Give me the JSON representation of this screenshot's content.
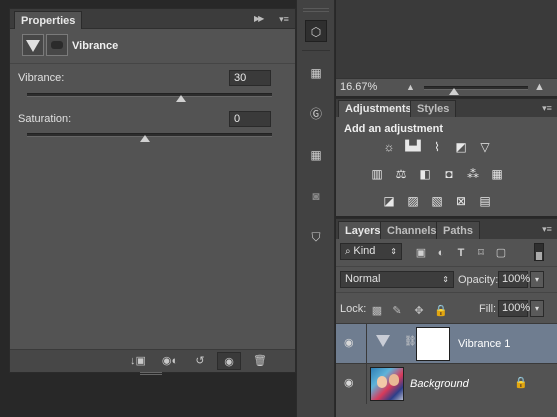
{
  "properties_panel": {
    "tab_title": "Properties",
    "header_title": "Vibrance",
    "vibrance": {
      "label": "Vibrance:",
      "value": "30",
      "slider_fraction": 0.63
    },
    "saturation": {
      "label": "Saturation:",
      "value": "0",
      "slider_fraction": 0.5
    }
  },
  "navigator": {
    "zoom": "16.67%"
  },
  "adjustments_panel": {
    "tabs": [
      "Adjustments",
      "Styles"
    ],
    "heading": "Add an adjustment",
    "icons_row1": [
      "brightness-contrast-icon",
      "levels-icon",
      "curves-icon",
      "exposure-icon",
      "vibrance-icon"
    ],
    "icons_row2": [
      "hue-saturation-icon",
      "color-balance-icon",
      "black-white-icon",
      "photo-filter-icon",
      "channel-mixer-icon",
      "color-lookup-icon"
    ],
    "icons_row3": [
      "invert-icon",
      "posterize-icon",
      "threshold-icon",
      "selective-color-icon",
      "gradient-map-icon"
    ]
  },
  "layers_panel": {
    "tabs": [
      "Layers",
      "Channels",
      "Paths"
    ],
    "filter_kind": "Kind",
    "blend_mode": "Normal",
    "opacity_label": "Opacity:",
    "opacity_value": "100%",
    "lock_label": "Lock:",
    "fill_label": "Fill:",
    "fill_value": "100%",
    "layers": [
      {
        "name": "Vibrance 1",
        "selected": true,
        "type": "adjustment"
      },
      {
        "name": "Background",
        "selected": false,
        "type": "image",
        "locked": true
      }
    ]
  },
  "colors": {
    "panel_bg": "#535353",
    "selected_layer": "#6f7d90",
    "tab_bar": "#3c3c3c"
  }
}
